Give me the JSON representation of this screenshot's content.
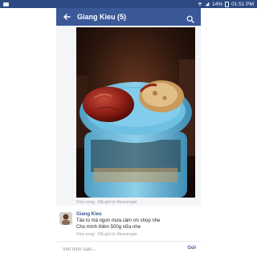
{
  "status_bar": {
    "battery": "14%",
    "time": "01:51 PM"
  },
  "app_bar": {
    "title": "Giang Kieu (5)",
    "back_icon": "arrow-left-icon",
    "search_icon": "search-icon"
  },
  "photo": {
    "description_icon": "photo",
    "meta": "Vừa xong · Đã gửi từ Messenger"
  },
  "comment": {
    "author": "Giang Kieu",
    "lines": [
      "Táo to mà ngon mưa cảm ơn shop nhe",
      "Cho mình thêm 500g nữa nhe"
    ],
    "meta": "Vừa xong · Đã gửi từ Messenger"
  },
  "composer": {
    "placeholder": "Viết bình luận...",
    "send_label": "Gửi"
  },
  "colors": {
    "status_bar": "#2d4a83",
    "app_bar": "#3b5998",
    "link": "#3b5998"
  }
}
